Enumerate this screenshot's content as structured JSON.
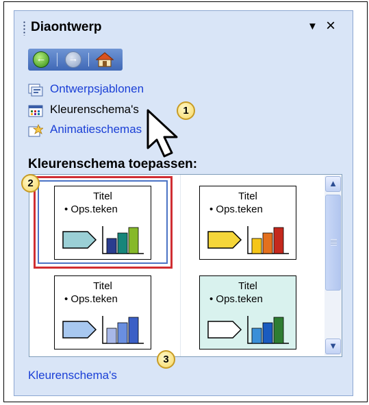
{
  "pane": {
    "title": "Diaontwerp",
    "dropdown_glyph": "▼",
    "close_glyph": "×"
  },
  "nav": {
    "back_icon": "back-icon",
    "forward_icon": "forward-icon",
    "home_icon": "home-icon"
  },
  "links": [
    {
      "label": "Ontwerpsjablonen",
      "icon": "design-template-icon",
      "style": "link"
    },
    {
      "label": "Kleurenschema's",
      "icon": "color-scheme-icon",
      "style": "selected"
    },
    {
      "label": "Animatieschemas",
      "icon": "animation-scheme-icon",
      "style": "link"
    }
  ],
  "section_title": "Kleurenschema toepassen:",
  "schemes": [
    {
      "title": "Titel",
      "bullet": "• Ops.teken",
      "selected": true,
      "colors": {
        "background": "#ffffff",
        "arrow": "#9bd0d6",
        "bars": [
          "#2a3d8f",
          "#17867a",
          "#86b92a"
        ]
      }
    },
    {
      "title": "Titel",
      "bullet": "• Ops.teken",
      "selected": false,
      "colors": {
        "background": "#ffffff",
        "arrow": "#f5d63a",
        "bars": [
          "#f5c518",
          "#e4701e",
          "#c4281d"
        ]
      }
    },
    {
      "title": "Titel",
      "bullet": "• Ops.teken",
      "selected": false,
      "colors": {
        "background": "#ffffff",
        "arrow": "#a8c8f0",
        "bars": [
          "#a8b8e8",
          "#6a8fe0",
          "#3b5fc6"
        ]
      }
    },
    {
      "title": "Titel",
      "bullet": "• Ops.teken",
      "selected": false,
      "colors": {
        "background": "#d9f2ee",
        "arrow": "#ffffff",
        "bars": [
          "#3a8fd8",
          "#1a5bbf",
          "#2e7d32"
        ]
      }
    }
  ],
  "callouts": [
    "1",
    "2",
    "3"
  ],
  "scrollbar": {
    "up_glyph": "▲",
    "down_glyph": "▼"
  },
  "bottom_link": "Kleurenschema's",
  "colors": {
    "pane_bg": "#d9e5f7",
    "link": "#1a3fd6",
    "selection_red": "#d02e32",
    "selection_blue": "#4a72c5",
    "callout_fill": "#f7d865"
  }
}
